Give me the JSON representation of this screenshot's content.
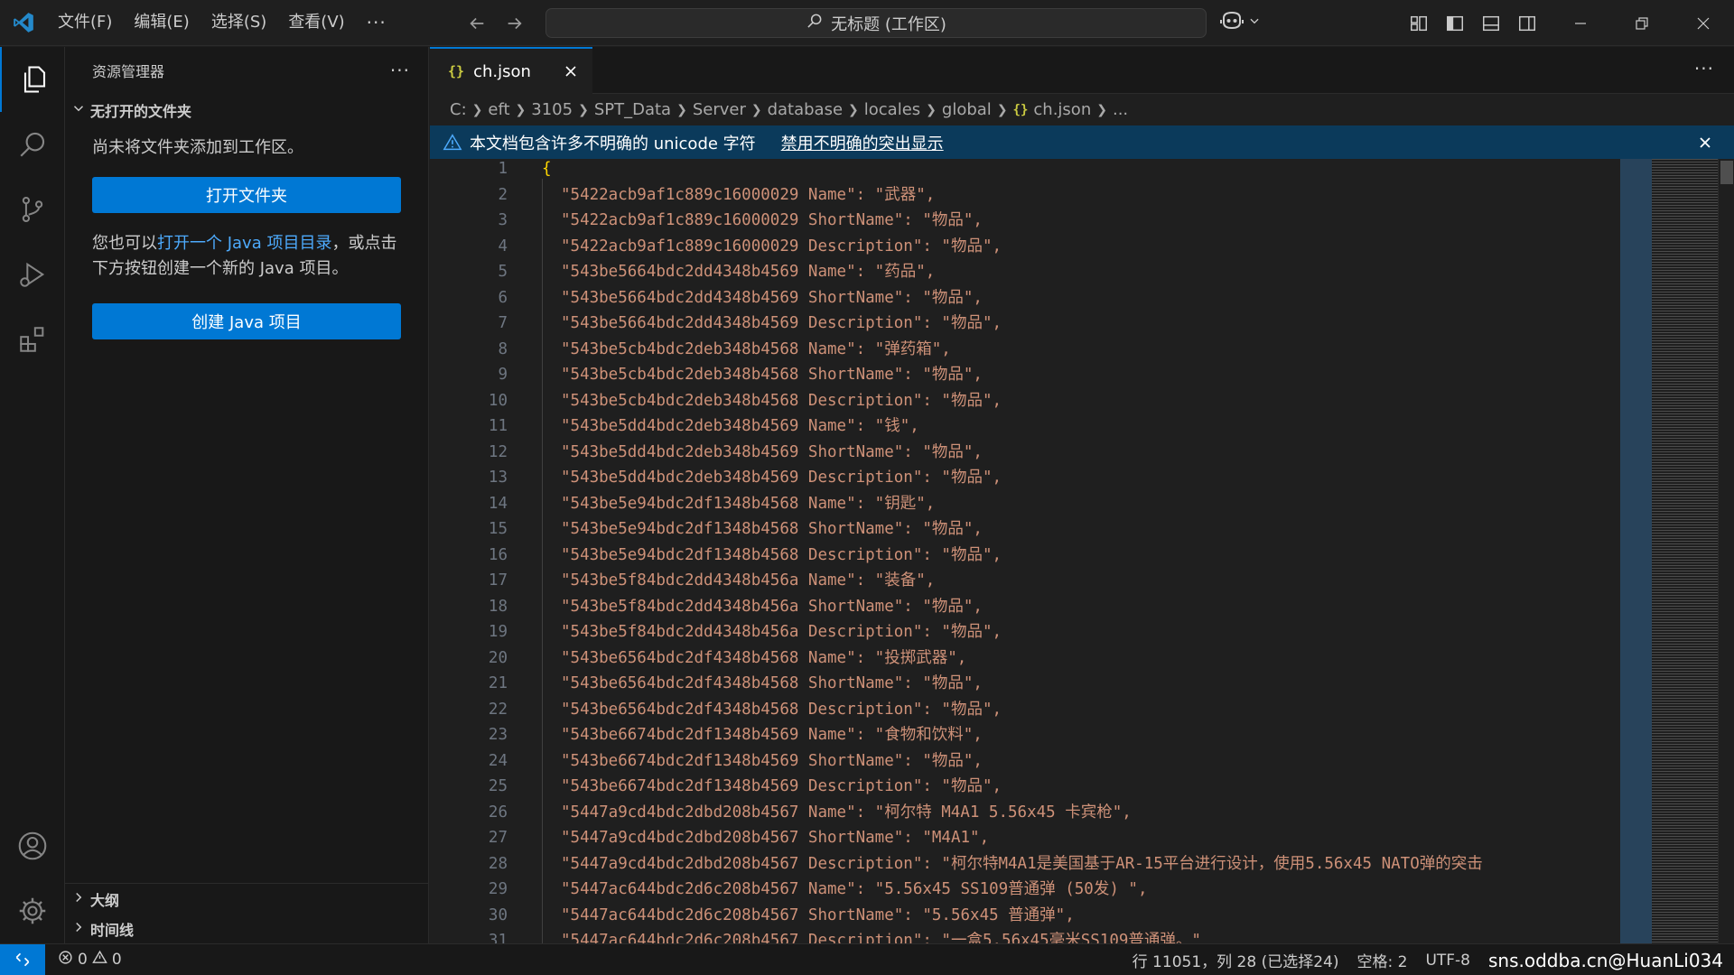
{
  "titlebar": {
    "menus": [
      "文件(F)",
      "编辑(E)",
      "选择(S)",
      "查看(V)"
    ],
    "more": "···",
    "command_center": "无标题 (工作区)"
  },
  "sidebar": {
    "title": "资源管理器",
    "more": "···",
    "section_no_folder": "无打开的文件夹",
    "no_folder_text": "尚未将文件夹添加到工作区。",
    "open_folder_button": "打开文件夹",
    "java_text_prefix": "您也可以",
    "java_text_link": "打开一个 Java 项目目录",
    "java_text_suffix": "，或点击下方按钮创建一个新的 Java 项目。",
    "create_java_button": "创建 Java 项目",
    "outline": "大纲",
    "timeline": "时间线"
  },
  "editor": {
    "tab": {
      "label": "ch.json",
      "icon": "{}"
    },
    "more": "···",
    "breadcrumb": [
      "C:",
      "eft",
      "3105",
      "SPT_Data",
      "Server",
      "database",
      "locales",
      "global",
      "ch.json",
      "..."
    ],
    "banner": {
      "message": "本文档包含许多不明确的 unicode 字符",
      "action": "禁用不明确的突出显示"
    },
    "lines": [
      {
        "n": "1",
        "text": "{"
      },
      {
        "n": "2",
        "text": "\"5422acb9af1c889c16000029 Name\": \"武器\","
      },
      {
        "n": "3",
        "text": "\"5422acb9af1c889c16000029 ShortName\": \"物品\","
      },
      {
        "n": "4",
        "text": "\"5422acb9af1c889c16000029 Description\": \"物品\","
      },
      {
        "n": "5",
        "text": "\"543be5664bdc2dd4348b4569 Name\": \"药品\","
      },
      {
        "n": "6",
        "text": "\"543be5664bdc2dd4348b4569 ShortName\": \"物品\","
      },
      {
        "n": "7",
        "text": "\"543be5664bdc2dd4348b4569 Description\": \"物品\","
      },
      {
        "n": "8",
        "text": "\"543be5cb4bdc2deb348b4568 Name\": \"弹药箱\","
      },
      {
        "n": "9",
        "text": "\"543be5cb4bdc2deb348b4568 ShortName\": \"物品\","
      },
      {
        "n": "10",
        "text": "\"543be5cb4bdc2deb348b4568 Description\": \"物品\","
      },
      {
        "n": "11",
        "text": "\"543be5dd4bdc2deb348b4569 Name\": \"钱\","
      },
      {
        "n": "12",
        "text": "\"543be5dd4bdc2deb348b4569 ShortName\": \"物品\","
      },
      {
        "n": "13",
        "text": "\"543be5dd4bdc2deb348b4569 Description\": \"物品\","
      },
      {
        "n": "14",
        "text": "\"543be5e94bdc2df1348b4568 Name\": \"钥匙\","
      },
      {
        "n": "15",
        "text": "\"543be5e94bdc2df1348b4568 ShortName\": \"物品\","
      },
      {
        "n": "16",
        "text": "\"543be5e94bdc2df1348b4568 Description\": \"物品\","
      },
      {
        "n": "17",
        "text": "\"543be5f84bdc2dd4348b456a Name\": \"装备\","
      },
      {
        "n": "18",
        "text": "\"543be5f84bdc2dd4348b456a ShortName\": \"物品\","
      },
      {
        "n": "19",
        "text": "\"543be5f84bdc2dd4348b456a Description\": \"物品\","
      },
      {
        "n": "20",
        "text": "\"543be6564bdc2df4348b4568 Name\": \"投掷武器\","
      },
      {
        "n": "21",
        "text": "\"543be6564bdc2df4348b4568 ShortName\": \"物品\","
      },
      {
        "n": "22",
        "text": "\"543be6564bdc2df4348b4568 Description\": \"物品\","
      },
      {
        "n": "23",
        "text": "\"543be6674bdc2df1348b4569 Name\": \"食物和饮料\","
      },
      {
        "n": "24",
        "text": "\"543be6674bdc2df1348b4569 ShortName\": \"物品\","
      },
      {
        "n": "25",
        "text": "\"543be6674bdc2df1348b4569 Description\": \"物品\","
      },
      {
        "n": "26",
        "text": "\"5447a9cd4bdc2dbd208b4567 Name\": \"柯尔特 M4A1 5.56x45 卡宾枪\","
      },
      {
        "n": "27",
        "text": "\"5447a9cd4bdc2dbd208b4567 ShortName\": \"M4A1\","
      },
      {
        "n": "28",
        "text": "\"5447a9cd4bdc2dbd208b4567 Description\": \"柯尔特M4A1是美国基于AR-15平台进行设计，使用5.56x45 NATO弹的突击"
      },
      {
        "n": "29",
        "text": "\"5447ac644bdc2d6c208b4567 Name\": \"5.56x45 SS109普通弹 (50发) \","
      },
      {
        "n": "30",
        "text": "\"5447ac644bdc2d6c208b4567 ShortName\": \"5.56x45 普通弹\","
      },
      {
        "n": "31",
        "text": "\"5447ac644bdc2d6c208b4567 Description\": \"一盒5.56x45毫米SS109普通弹。\""
      }
    ]
  },
  "statusbar": {
    "errors": "0",
    "warnings": "0",
    "position": "行 11051，列 28 (已选择24)",
    "spaces": "空格: 2",
    "encoding": "UTF-8",
    "watermark": "sns.oddba.cn@HuanLi034"
  },
  "colors": {
    "accent": "#0078d4",
    "banner_bg": "#0b3a5b",
    "string": "#ce9178",
    "brace": "#ffd700",
    "json_icon": "#cbcb41"
  }
}
